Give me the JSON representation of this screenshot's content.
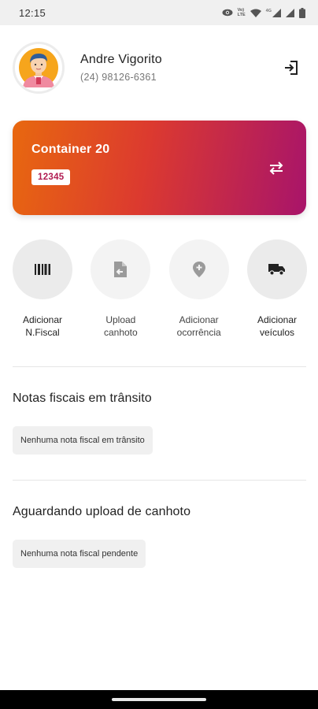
{
  "status_bar": {
    "time": "12:15",
    "icons": [
      "eye-icon",
      "volte-icon",
      "wifi-icon",
      "4g-icon",
      "signal-icon",
      "signal-icon-2",
      "battery-icon"
    ],
    "volte_text_top": "Vo)",
    "volte_text_bottom": "LTE",
    "network_text": "4G"
  },
  "user": {
    "name": "Andre Vigorito",
    "phone": "(24) 98126-6361"
  },
  "container": {
    "title": "Container 20",
    "code": "12345"
  },
  "actions": [
    {
      "label": "Adicionar\nN.Fiscal",
      "icon": "barcode-icon"
    },
    {
      "label": "Upload\ncanhoto",
      "icon": "document-upload-icon"
    },
    {
      "label": "Adicionar\nocorrência",
      "icon": "location-add-icon"
    },
    {
      "label": "Adicionar\nveículos",
      "icon": "truck-icon"
    }
  ],
  "sections": {
    "transit": {
      "title": "Notas fiscais em trânsito",
      "empty_message": "Nenhuma nota fiscal em trânsito"
    },
    "pending": {
      "title": "Aguardando upload de canhoto",
      "empty_message": "Nenhuma nota fiscal pendente"
    }
  },
  "colors": {
    "card_gradient_start": "#e8680f",
    "card_gradient_mid": "#dc3a2f",
    "card_gradient_end": "#a8146a",
    "code_text": "#b01a50"
  }
}
